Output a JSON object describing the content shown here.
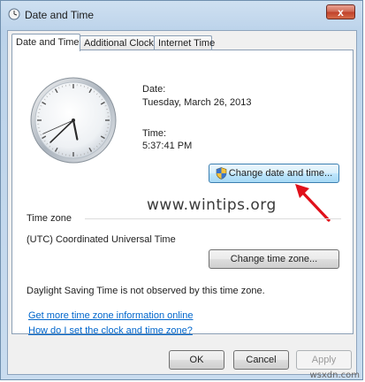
{
  "window": {
    "title": "Date and Time",
    "close_glyph": "x"
  },
  "tabs": [
    {
      "label": "Date and Time",
      "active": true
    },
    {
      "label": "Additional Clocks",
      "active": false
    },
    {
      "label": "Internet Time",
      "active": false
    }
  ],
  "clock": {
    "hours": 5,
    "minutes": 37,
    "seconds": 41
  },
  "date": {
    "label": "Date:",
    "value": "Tuesday, March 26, 2013"
  },
  "time": {
    "label": "Time:",
    "value": "5:37:41 PM"
  },
  "change_date_button": "Change date and time...",
  "timezone": {
    "heading": "Time zone",
    "value": "(UTC) Coordinated Universal Time",
    "change_button": "Change time zone...",
    "dst_note": "Daylight Saving Time is not observed by this time zone."
  },
  "watermark": "www.wintips.org",
  "links": [
    "Get more time zone information online",
    "How do I set the clock and time zone?"
  ],
  "buttons": {
    "ok": "OK",
    "cancel": "Cancel",
    "apply": "Apply"
  },
  "corner_watermark": "wsxdn.com",
  "colors": {
    "link": "#0066cc",
    "annotation_arrow": "#e0101a",
    "close_button": "#c0412a"
  }
}
